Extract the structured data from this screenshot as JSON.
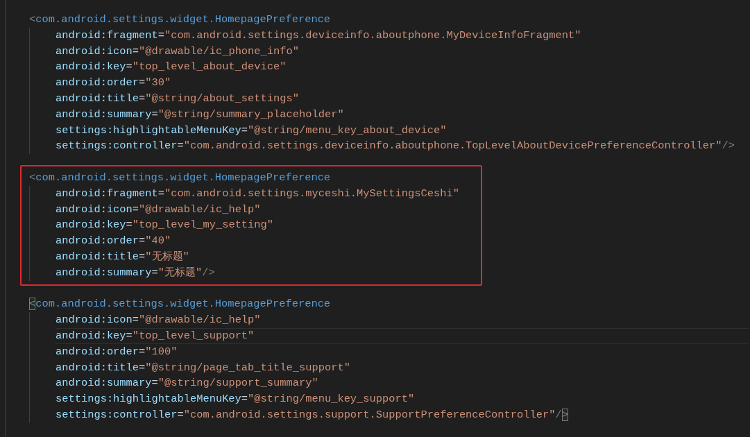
{
  "editor": {
    "blocks": [
      {
        "highlighted": false,
        "lines": [
          {
            "kind": "tag",
            "current": false,
            "tokens": [
              {
                "kind": "punct",
                "text": "<"
              },
              {
                "kind": "tag",
                "text": "com.android.settings.widget.HomepagePreference"
              }
            ]
          },
          {
            "kind": "attribute",
            "current": false,
            "tokens": [
              {
                "kind": "attr",
                "text": "android:fragment"
              },
              {
                "kind": "eq",
                "text": "="
              },
              {
                "kind": "string",
                "text": "\"com.android.settings.deviceinfo.aboutphone.MyDeviceInfoFragment\""
              }
            ]
          },
          {
            "kind": "attribute",
            "current": false,
            "tokens": [
              {
                "kind": "attr",
                "text": "android:icon"
              },
              {
                "kind": "eq",
                "text": "="
              },
              {
                "kind": "string",
                "text": "\"@drawable/ic_phone_info\""
              }
            ]
          },
          {
            "kind": "attribute",
            "current": false,
            "tokens": [
              {
                "kind": "attr",
                "text": "android:key"
              },
              {
                "kind": "eq",
                "text": "="
              },
              {
                "kind": "string",
                "text": "\"top_level_about_device\""
              }
            ]
          },
          {
            "kind": "attribute",
            "current": false,
            "tokens": [
              {
                "kind": "attr",
                "text": "android:order"
              },
              {
                "kind": "eq",
                "text": "="
              },
              {
                "kind": "string",
                "text": "\"30\""
              }
            ]
          },
          {
            "kind": "attribute",
            "current": false,
            "tokens": [
              {
                "kind": "attr",
                "text": "android:title"
              },
              {
                "kind": "eq",
                "text": "="
              },
              {
                "kind": "string",
                "text": "\"@string/about_settings\""
              }
            ]
          },
          {
            "kind": "attribute",
            "current": false,
            "tokens": [
              {
                "kind": "attr",
                "text": "android:summary"
              },
              {
                "kind": "eq",
                "text": "="
              },
              {
                "kind": "string",
                "text": "\"@string/summary_placeholder\""
              }
            ]
          },
          {
            "kind": "attribute",
            "current": false,
            "tokens": [
              {
                "kind": "attr",
                "text": "settings:highlightableMenuKey"
              },
              {
                "kind": "eq",
                "text": "="
              },
              {
                "kind": "string",
                "text": "\"@string/menu_key_about_device\""
              }
            ]
          },
          {
            "kind": "attribute",
            "current": false,
            "tokens": [
              {
                "kind": "attr",
                "text": "settings:controller"
              },
              {
                "kind": "eq",
                "text": "="
              },
              {
                "kind": "string",
                "text": "\"com.android.settings.deviceinfo.aboutphone.TopLevelAboutDevicePreferenceController\""
              },
              {
                "kind": "punct",
                "text": "/>"
              }
            ]
          }
        ]
      },
      {
        "highlighted": true,
        "lines": [
          {
            "kind": "tag",
            "current": false,
            "tokens": [
              {
                "kind": "punct",
                "text": "<"
              },
              {
                "kind": "tag",
                "text": "com.android.settings.widget.HomepagePreference"
              }
            ]
          },
          {
            "kind": "attribute",
            "current": false,
            "tokens": [
              {
                "kind": "attr",
                "text": "android:fragment"
              },
              {
                "kind": "eq",
                "text": "="
              },
              {
                "kind": "string",
                "text": "\"com.android.settings.myceshi.MySettingsCeshi\""
              }
            ]
          },
          {
            "kind": "attribute",
            "current": false,
            "tokens": [
              {
                "kind": "attr",
                "text": "android:icon"
              },
              {
                "kind": "eq",
                "text": "="
              },
              {
                "kind": "string",
                "text": "\"@drawable/ic_help\""
              }
            ]
          },
          {
            "kind": "attribute",
            "current": false,
            "tokens": [
              {
                "kind": "attr",
                "text": "android:key"
              },
              {
                "kind": "eq",
                "text": "="
              },
              {
                "kind": "string",
                "text": "\"top_level_my_setting\""
              }
            ]
          },
          {
            "kind": "attribute",
            "current": false,
            "tokens": [
              {
                "kind": "attr",
                "text": "android:order"
              },
              {
                "kind": "eq",
                "text": "="
              },
              {
                "kind": "string",
                "text": "\"40\""
              }
            ]
          },
          {
            "kind": "attribute",
            "current": false,
            "tokens": [
              {
                "kind": "attr",
                "text": "android:title"
              },
              {
                "kind": "eq",
                "text": "="
              },
              {
                "kind": "string",
                "text": "\"无标题\""
              }
            ]
          },
          {
            "kind": "attribute",
            "current": false,
            "tokens": [
              {
                "kind": "attr",
                "text": "android:summary"
              },
              {
                "kind": "eq",
                "text": "="
              },
              {
                "kind": "string",
                "text": "\"无标题\""
              },
              {
                "kind": "punct",
                "text": "/>"
              }
            ]
          }
        ]
      },
      {
        "highlighted": false,
        "lines": [
          {
            "kind": "tag",
            "current": false,
            "tokens": [
              {
                "kind": "punct",
                "text": "<",
                "bracket_match": true
              },
              {
                "kind": "tag",
                "text": "com.android.settings.widget.HomepagePreference"
              }
            ]
          },
          {
            "kind": "attribute",
            "current": false,
            "tokens": [
              {
                "kind": "attr",
                "text": "android:icon"
              },
              {
                "kind": "eq",
                "text": "="
              },
              {
                "kind": "string",
                "text": "\"@drawable/ic_help\""
              }
            ]
          },
          {
            "kind": "attribute",
            "current": true,
            "tokens": [
              {
                "kind": "attr",
                "text": "android:key"
              },
              {
                "kind": "eq",
                "text": "="
              },
              {
                "kind": "string",
                "text": "\"top_level_support\""
              }
            ]
          },
          {
            "kind": "attribute",
            "current": false,
            "tokens": [
              {
                "kind": "attr",
                "text": "android:order"
              },
              {
                "kind": "eq",
                "text": "="
              },
              {
                "kind": "string",
                "text": "\"100\""
              }
            ]
          },
          {
            "kind": "attribute",
            "current": false,
            "tokens": [
              {
                "kind": "attr",
                "text": "android:title"
              },
              {
                "kind": "eq",
                "text": "="
              },
              {
                "kind": "string",
                "text": "\"@string/page_tab_title_support\""
              }
            ]
          },
          {
            "kind": "attribute",
            "current": false,
            "tokens": [
              {
                "kind": "attr",
                "text": "android:summary"
              },
              {
                "kind": "eq",
                "text": "="
              },
              {
                "kind": "string",
                "text": "\"@string/support_summary\""
              }
            ]
          },
          {
            "kind": "attribute",
            "current": false,
            "tokens": [
              {
                "kind": "attr",
                "text": "settings:highlightableMenuKey"
              },
              {
                "kind": "eq",
                "text": "="
              },
              {
                "kind": "string",
                "text": "\"@string/menu_key_support\""
              }
            ]
          },
          {
            "kind": "attribute",
            "current": false,
            "tokens": [
              {
                "kind": "attr",
                "text": "settings:controller"
              },
              {
                "kind": "eq",
                "text": "="
              },
              {
                "kind": "string",
                "text": "\"com.android.settings.support.SupportPreferenceController\""
              },
              {
                "kind": "punct",
                "text": "/"
              },
              {
                "kind": "punct",
                "text": ">",
                "bracket_match": true
              }
            ]
          }
        ]
      }
    ]
  }
}
